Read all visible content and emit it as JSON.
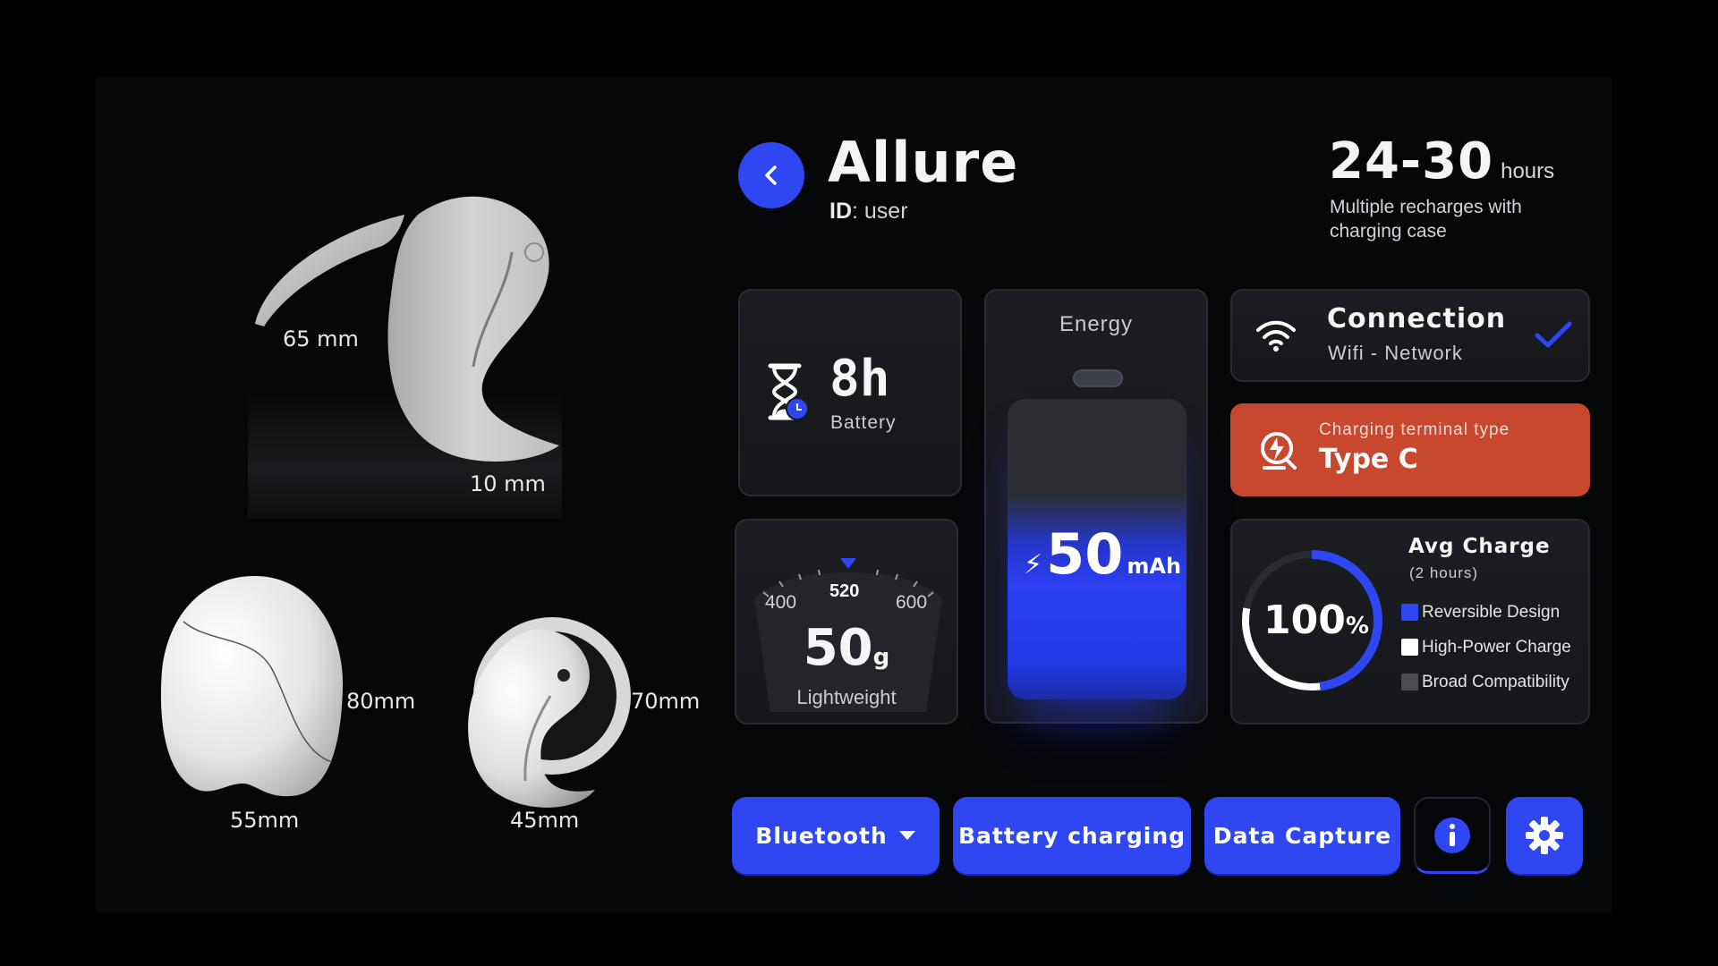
{
  "header": {
    "title": "Allure",
    "id_label": "ID",
    "id_value": ": user",
    "hours_value": "24-30",
    "hours_unit": "hours",
    "hours_desc": "Multiple recharges with charging case"
  },
  "dimensions": {
    "hook_length": "65 mm",
    "hook_thickness": "10 mm",
    "shell_height": "80mm",
    "shell_width": "55mm",
    "bud_height": "70mm",
    "bud_width": "45mm"
  },
  "battery_card": {
    "value": "8h",
    "label": "Battery"
  },
  "energy_card": {
    "label": "Energy",
    "value": "50",
    "unit": "mAh",
    "fill_fraction": 0.6
  },
  "weight_card": {
    "value": "50",
    "unit": "g",
    "label": "Lightweight",
    "scale_left": "400",
    "scale_mid": "520",
    "scale_right": "600"
  },
  "connection_card": {
    "title": "Connection",
    "subtitle": "Wifi - Network"
  },
  "charging_card": {
    "subtitle": "Charging terminal type",
    "title": "Type C"
  },
  "avg_card": {
    "title": "Avg Charge",
    "subtitle": "(2 hours)",
    "value": "100",
    "unit": "%",
    "ring_fraction": 0.48,
    "legend": [
      {
        "label": "Reversible Design",
        "color": "#2f47f2"
      },
      {
        "label": "High-Power Charge",
        "color": "#ffffff"
      },
      {
        "label": "Broad Compatibility",
        "color": "#4a4c52"
      }
    ]
  },
  "buttons": {
    "bluetooth": "Bluetooth",
    "battery_charging": "Battery charging",
    "data_capture": "Data Capture"
  },
  "colors": {
    "accent": "#2f47f2",
    "charge_card": "#c8472f",
    "background": "#060709"
  }
}
